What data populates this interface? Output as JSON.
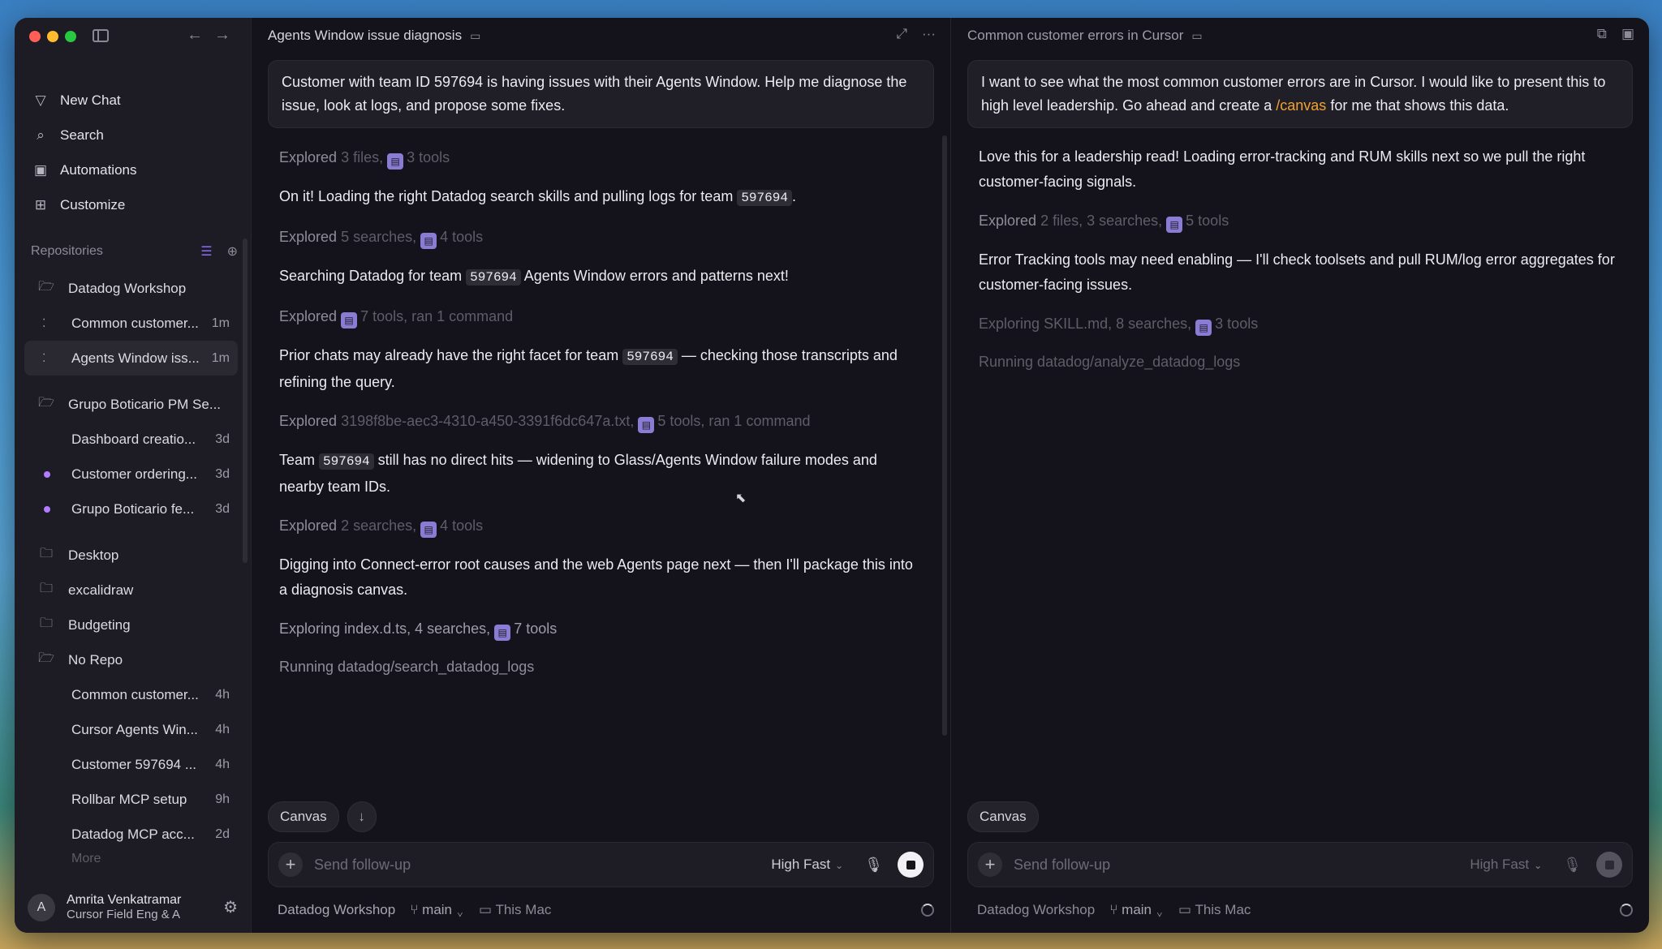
{
  "sidebar": {
    "nav": [
      {
        "label": "New Chat",
        "icon": "new-chat-icon"
      },
      {
        "label": "Search",
        "icon": "search-icon"
      },
      {
        "label": "Automations",
        "icon": "automations-icon"
      },
      {
        "label": "Customize",
        "icon": "customize-icon"
      }
    ],
    "repos_label": "Repositories",
    "groups": [
      {
        "name": "Datadog Workshop",
        "chats": [
          {
            "label": "Common customer...",
            "age": "1m",
            "active": false,
            "marker": "spinner"
          },
          {
            "label": "Agents Window iss...",
            "age": "1m",
            "active": true,
            "marker": "spinner"
          }
        ]
      },
      {
        "name": "Grupo Boticario PM Se...",
        "chats": [
          {
            "label": "Dashboard creatio...",
            "age": "3d",
            "marker": "none"
          },
          {
            "label": "Customer ordering...",
            "age": "3d",
            "marker": "dot"
          },
          {
            "label": "Grupo Boticario fe...",
            "age": "3d",
            "marker": "dot"
          }
        ]
      },
      {
        "name": "Desktop",
        "chats": []
      },
      {
        "name": "excalidraw",
        "chats": []
      },
      {
        "name": "Budgeting",
        "chats": []
      },
      {
        "name": "No Repo",
        "chats": [
          {
            "label": "Common customer...",
            "age": "4h",
            "marker": "none"
          },
          {
            "label": "Cursor Agents Win...",
            "age": "4h",
            "marker": "none"
          },
          {
            "label": "Customer 597694 ...",
            "age": "4h",
            "marker": "none"
          },
          {
            "label": "Rollbar MCP setup",
            "age": "9h",
            "marker": "none"
          },
          {
            "label": "Datadog MCP acc...",
            "age": "2d",
            "marker": "none"
          }
        ]
      }
    ],
    "more_label": "More",
    "user": {
      "initial": "A",
      "name": "Amrita Venkatramar",
      "org": "Cursor Field Eng & A"
    }
  },
  "left_panel": {
    "title": "Agents Window issue diagnosis",
    "prompt": "Customer with team ID 597694 is having issues with their Agents Window. Help me diagnose the issue, look at logs, and propose some fixes.",
    "s1": {
      "verb": "Explored",
      "detail": "3 files,",
      "tools": "3 tools"
    },
    "m1": {
      "a": "On it! Loading the right Datadog search skills and pulling logs for team ",
      "code": "597694",
      "b": "."
    },
    "s2": {
      "verb": "Explored",
      "detail": "5 searches,",
      "tools": "4 tools"
    },
    "m2": {
      "a": "Searching Datadog for team ",
      "code": "597694",
      "b": " Agents Window errors and patterns next!"
    },
    "s3": {
      "verb": "Explored",
      "detail": "",
      "tools": "7 tools, ran 1 command"
    },
    "m3": {
      "a": "Prior chats may already have the right facet for team ",
      "code": "597694",
      "b": " — checking those transcripts and refining the query."
    },
    "s4": {
      "verb": "Explored",
      "detail": "3198f8be-aec3-4310-a450-3391f6dc647a.txt,",
      "tools": "5 tools, ran 1 command"
    },
    "m4": {
      "a": "Team ",
      "code": "597694",
      "b": " still has no direct hits — widening to Glass/Agents Window failure modes and nearby team IDs."
    },
    "s5": {
      "verb": "Explored",
      "detail": "2 searches,",
      "tools": "4 tools"
    },
    "m5": "Digging into Connect-error root causes and the web Agents page next — then I'll package this into a diagnosis canvas.",
    "s6": {
      "verb": "Exploring",
      "detail": "index.d.ts, 4 searches,",
      "tools": "7 tools"
    },
    "running": "Running datadog/search_datadog_logs",
    "chip": "Canvas",
    "composer": {
      "placeholder": "Send follow-up",
      "model": "High Fast"
    },
    "footer": {
      "repo": "Datadog Workshop",
      "branch": "main",
      "machine": "This Mac"
    }
  },
  "right_panel": {
    "title": "Common customer errors in Cursor",
    "prompt_a": "I want to see what the most common customer errors are in Cursor. I would like to present this to high level leadership. Go ahead and create a ",
    "prompt_cmd": "/canvas",
    "prompt_b": " for me that shows this data.",
    "m1": "Love this for a leadership read! Loading error-tracking and RUM skills next so we pull the right customer-facing signals.",
    "s1": {
      "verb": "Explored",
      "detail": "2 files, 3 searches,",
      "tools": "5 tools"
    },
    "m2": "Error Tracking tools may need enabling — I'll check toolsets and pull RUM/log error aggregates for customer-facing issues.",
    "s2": {
      "verb": "Exploring",
      "detail": "SKILL.md, 8 searches,",
      "tools": "3 tools"
    },
    "running": "Running datadog/analyze_datadog_logs",
    "chip": "Canvas",
    "composer": {
      "placeholder": "Send follow-up",
      "model": "High Fast"
    },
    "footer": {
      "repo": "Datadog Workshop",
      "branch": "main",
      "machine": "This Mac"
    }
  }
}
